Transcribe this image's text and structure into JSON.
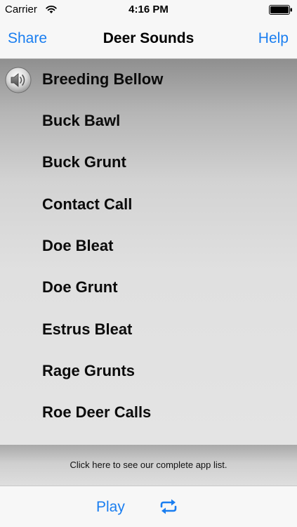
{
  "status_bar": {
    "carrier": "Carrier",
    "time": "4:16 PM",
    "wifi_icon": "wifi-icon",
    "battery_icon": "battery-icon"
  },
  "nav": {
    "share_label": "Share",
    "title": "Deer Sounds",
    "help_label": "Help"
  },
  "sounds": {
    "playing_indicator_icon": "speaker-icon",
    "playing_index": 0,
    "items": [
      {
        "label": "Breeding Bellow"
      },
      {
        "label": "Buck Bawl"
      },
      {
        "label": "Buck Grunt"
      },
      {
        "label": "Contact Call"
      },
      {
        "label": "Doe Bleat"
      },
      {
        "label": "Doe Grunt"
      },
      {
        "label": "Estrus Bleat"
      },
      {
        "label": "Rage Grunts"
      },
      {
        "label": "Roe Deer Calls"
      }
    ]
  },
  "banner": {
    "text": "Click here to see our complete app list."
  },
  "toolbar": {
    "play_label": "Play",
    "repeat_icon": "repeat-icon"
  },
  "colors": {
    "accent": "#1a7ef0",
    "bar_background": "#f7f7f7"
  }
}
